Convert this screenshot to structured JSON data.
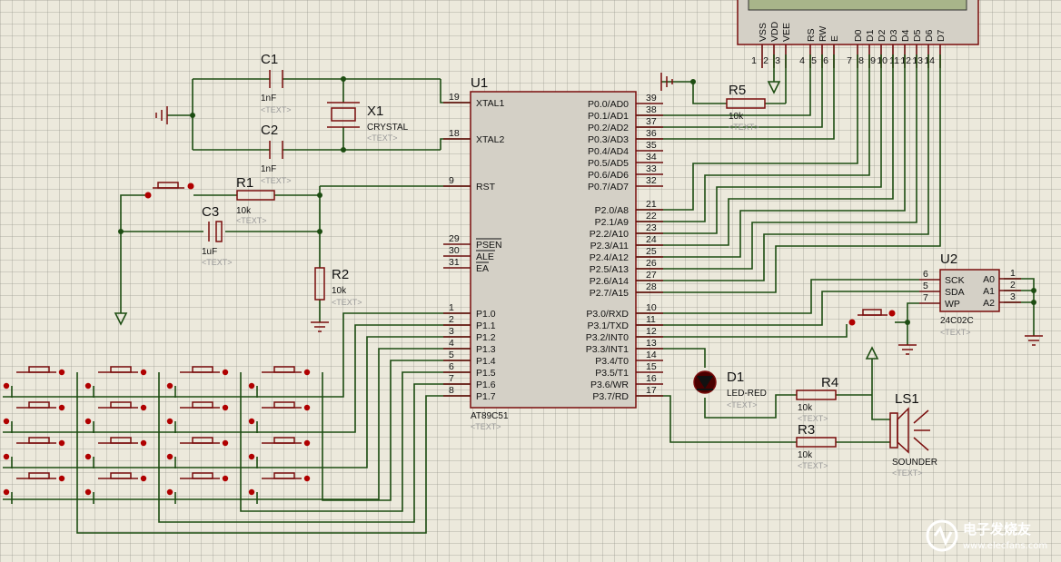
{
  "components": {
    "u1": {
      "ref": "U1",
      "part": "AT89C51",
      "text": "<TEXT>"
    },
    "u2": {
      "ref": "U2",
      "part": "24C02C",
      "text": "<TEXT>"
    },
    "c1": {
      "ref": "C1",
      "value": "1nF",
      "text": "<TEXT>"
    },
    "c2": {
      "ref": "C2",
      "value": "1nF",
      "text": "<TEXT>"
    },
    "c3": {
      "ref": "C3",
      "value": "1uF",
      "text": "<TEXT>"
    },
    "x1": {
      "ref": "X1",
      "value": "CRYSTAL",
      "text": "<TEXT>"
    },
    "r1": {
      "ref": "R1",
      "value": "10k",
      "text": "<TEXT>"
    },
    "r2": {
      "ref": "R2",
      "value": "10k",
      "text": "<TEXT>"
    },
    "r3": {
      "ref": "R3",
      "value": "10k",
      "text": "<TEXT>"
    },
    "r4": {
      "ref": "R4",
      "value": "10k",
      "text": "<TEXT>"
    },
    "r5": {
      "ref": "R5",
      "value": "10k",
      "text": "<TEXT>"
    },
    "d1": {
      "ref": "D1",
      "value": "LED-RED",
      "text": "<TEXT>"
    },
    "ls1": {
      "ref": "LS1",
      "value": "SOUNDER",
      "text": "<TEXT>"
    }
  },
  "u1_left_pins": [
    {
      "num": "19",
      "name": "XTAL1"
    },
    {
      "num": "18",
      "name": "XTAL2"
    },
    {
      "num": "9",
      "name": "RST"
    },
    {
      "num": "29",
      "name": "PSEN"
    },
    {
      "num": "30",
      "name": "ALE"
    },
    {
      "num": "31",
      "name": "EA"
    },
    {
      "num": "1",
      "name": "P1.0"
    },
    {
      "num": "2",
      "name": "P1.1"
    },
    {
      "num": "3",
      "name": "P1.2"
    },
    {
      "num": "4",
      "name": "P1.3"
    },
    {
      "num": "5",
      "name": "P1.4"
    },
    {
      "num": "6",
      "name": "P1.5"
    },
    {
      "num": "7",
      "name": "P1.6"
    },
    {
      "num": "8",
      "name": "P1.7"
    }
  ],
  "u1_right_pins": [
    {
      "num": "39",
      "name": "P0.0/AD0"
    },
    {
      "num": "38",
      "name": "P0.1/AD1"
    },
    {
      "num": "37",
      "name": "P0.2/AD2"
    },
    {
      "num": "36",
      "name": "P0.3/AD3"
    },
    {
      "num": "35",
      "name": "P0.4/AD4"
    },
    {
      "num": "34",
      "name": "P0.5/AD5"
    },
    {
      "num": "33",
      "name": "P0.6/AD6"
    },
    {
      "num": "32",
      "name": "P0.7/AD7"
    },
    {
      "num": "21",
      "name": "P2.0/A8"
    },
    {
      "num": "22",
      "name": "P2.1/A9"
    },
    {
      "num": "23",
      "name": "P2.2/A10"
    },
    {
      "num": "24",
      "name": "P2.3/A11"
    },
    {
      "num": "25",
      "name": "P2.4/A12"
    },
    {
      "num": "26",
      "name": "P2.5/A13"
    },
    {
      "num": "27",
      "name": "P2.6/A14"
    },
    {
      "num": "28",
      "name": "P2.7/A15"
    },
    {
      "num": "10",
      "name": "P3.0/RXD"
    },
    {
      "num": "11",
      "name": "P3.1/TXD"
    },
    {
      "num": "12",
      "name": "P3.2/INT0"
    },
    {
      "num": "13",
      "name": "P3.3/INT1"
    },
    {
      "num": "14",
      "name": "P3.4/T0"
    },
    {
      "num": "15",
      "name": "P3.5/T1"
    },
    {
      "num": "16",
      "name": "P3.6/WR"
    },
    {
      "num": "17",
      "name": "P3.7/RD"
    }
  ],
  "u2_left_pins": [
    {
      "num": "6",
      "name": "SCK"
    },
    {
      "num": "5",
      "name": "SDA"
    },
    {
      "num": "7",
      "name": "WP"
    }
  ],
  "u2_right_pins": [
    {
      "num": "1",
      "name": "A0"
    },
    {
      "num": "2",
      "name": "A1"
    },
    {
      "num": "3",
      "name": "A2"
    }
  ],
  "lcd_pins": [
    {
      "num": "1",
      "name": "VSS"
    },
    {
      "num": "2",
      "name": "VDD"
    },
    {
      "num": "3",
      "name": "VEE"
    },
    {
      "num": "4",
      "name": "RS"
    },
    {
      "num": "5",
      "name": "RW"
    },
    {
      "num": "6",
      "name": "E"
    },
    {
      "num": "7",
      "name": "D0"
    },
    {
      "num": "8",
      "name": "D1"
    },
    {
      "num": "9",
      "name": "D2"
    },
    {
      "num": "10",
      "name": "D3"
    },
    {
      "num": "11",
      "name": "D4"
    },
    {
      "num": "12",
      "name": "D5"
    },
    {
      "num": "13",
      "name": "D6"
    },
    {
      "num": "14",
      "name": "D7"
    }
  ],
  "watermark": {
    "title": "电子发烧友",
    "url": "www.elecfans.com"
  },
  "colors": {
    "background": "#ece9dc",
    "wire": "#1d4d12",
    "component": "#7a0d0d",
    "chip_fill": "#d4d0c6",
    "junction": "#b00000"
  }
}
